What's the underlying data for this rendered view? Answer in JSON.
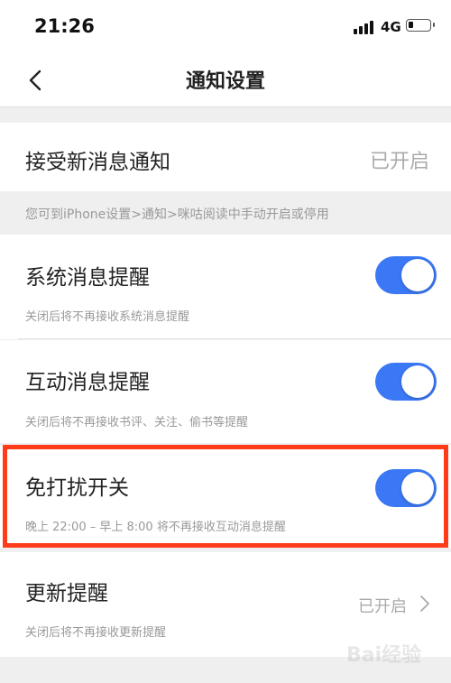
{
  "status_bar": {
    "time": "21:26",
    "network": "4G",
    "icons": [
      "signal-icon",
      "battery-icon"
    ]
  },
  "nav": {
    "title": "通知设置",
    "back_icon": "chevron-left-icon"
  },
  "accept_notifications": {
    "label": "接受新消息通知",
    "value": "已开启"
  },
  "hint": "您可到iPhone设置>通知>咪咕阅读中手动开启或停用",
  "settings": [
    {
      "label": "系统消息提醒",
      "description": "关闭后将不再接收系统消息提醒",
      "enabled": true
    },
    {
      "label": "互动消息提醒",
      "description": "关闭后将不再接收书评、关注、偷书等提醒",
      "enabled": true
    },
    {
      "label": "免打扰开关",
      "description": "晚上 22:00 – 早上 8:00 将不再接收互动消息提醒",
      "enabled": true
    }
  ],
  "update_reminder": {
    "label": "更新提醒",
    "description": "关闭后将不再接收更新提醒",
    "value": "已开启"
  },
  "colors": {
    "toggle_on": "#3b78f5",
    "highlight": "#ff3b1a",
    "background": "#efefef"
  },
  "watermark": "Bai经验"
}
